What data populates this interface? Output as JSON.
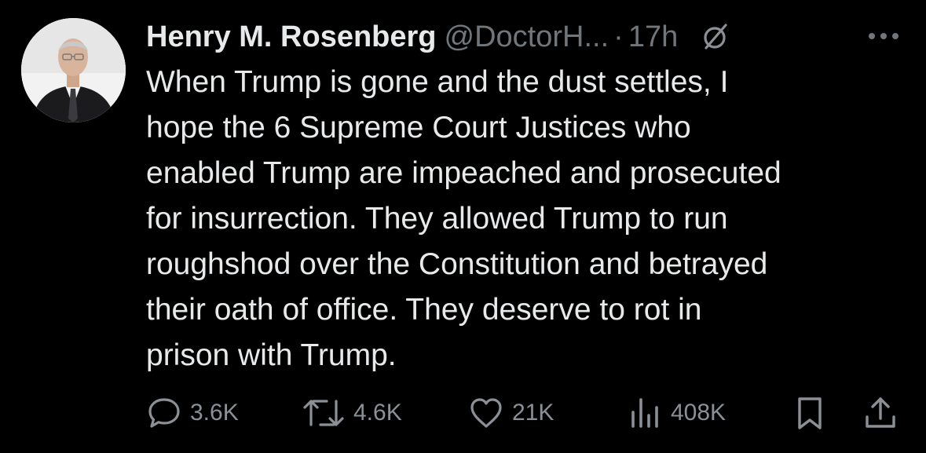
{
  "tweet": {
    "author_name": "Henry M. Rosenberg",
    "handle": "@DoctorH...",
    "separator": "·",
    "time": "17h",
    "text": "When Trump is gone and the dust settles, I\nhope the 6 Supreme Court Justices who\nenabled Trump are impeached and prosecuted\nfor insurrection. They allowed Trump to run\nroughshod over the Constitution and betrayed\ntheir oath of office. They deserve to rot in\nprison with Trump."
  },
  "actions": {
    "replies": "3.6K",
    "reposts": "4.6K",
    "likes": "21K",
    "views": "408K"
  },
  "icons": {
    "grok": "grok-slash-icon",
    "more": "more-horizontal-icon",
    "reply": "reply-bubble-icon",
    "repost": "repost-arrows-icon",
    "like": "heart-icon",
    "views": "bar-chart-icon",
    "bookmark": "bookmark-icon",
    "share": "share-upload-icon"
  },
  "colors": {
    "background": "#000000",
    "primary_text": "#e7e9ea",
    "secondary_text": "#71767b"
  }
}
